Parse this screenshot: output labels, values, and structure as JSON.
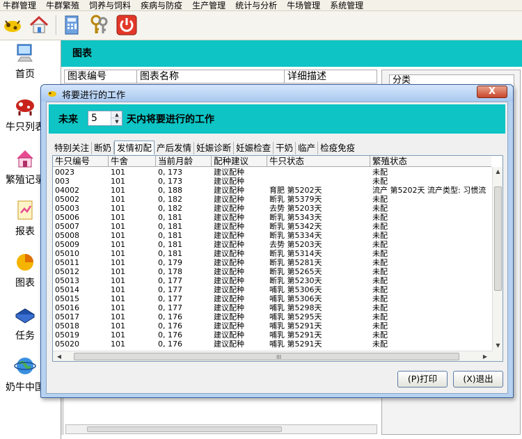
{
  "menu": [
    "牛群管理",
    "牛群繁殖",
    "饲养与饲料",
    "疾病与防疫",
    "生产管理",
    "统计与分析",
    "牛场管理",
    "系统管理"
  ],
  "nav": [
    {
      "label": "首页",
      "icon": "monitor-icon"
    },
    {
      "label": "牛只列表",
      "icon": "cow-icon"
    },
    {
      "label": "繁殖记录",
      "icon": "house-icon"
    },
    {
      "label": "报表",
      "icon": "report-icon"
    },
    {
      "label": "图表",
      "icon": "pie-chart-icon"
    },
    {
      "label": "任务",
      "icon": "book-icon"
    },
    {
      "label": "奶牛中国",
      "icon": "globe-icon"
    }
  ],
  "background": {
    "title": "图表",
    "headers": [
      "图表编号",
      "图表名称",
      "详细描述"
    ],
    "category": "分类"
  },
  "dialog": {
    "title": "将要进行的工作",
    "close": "X",
    "future": "未来",
    "days_value": "5",
    "days_label": "天内将要进行的工作",
    "tabs": [
      "特别关注",
      "断奶",
      "发情初配",
      "产后发情",
      "妊娠诊断",
      "妊娠检查",
      "干奶",
      "临产",
      "检疫免疫"
    ],
    "active_tab": 2,
    "columns": [
      "牛只编号",
      "牛舍",
      "当前月龄",
      "配种建议",
      "牛只状态",
      "繁殖状态"
    ],
    "rows": [
      [
        "0023",
        "101",
        "0, 173",
        "建议配种",
        "",
        "未配"
      ],
      [
        "003",
        "101",
        "0, 173",
        "建议配种",
        "",
        "未配"
      ],
      [
        "04002",
        "101",
        "0, 188",
        "建议配种",
        "育肥  第5202天",
        "流产  第5202天  流产类型: 习惯流"
      ],
      [
        "05002",
        "101",
        "0, 182",
        "建议配种",
        "断乳  第5379天",
        "未配"
      ],
      [
        "05003",
        "101",
        "0, 182",
        "建议配种",
        "去势  第5203天",
        "未配"
      ],
      [
        "05006",
        "101",
        "0, 181",
        "建议配种",
        "断乳  第5343天",
        "未配"
      ],
      [
        "05007",
        "101",
        "0, 181",
        "建议配种",
        "断乳  第5342天",
        "未配"
      ],
      [
        "05008",
        "101",
        "0, 181",
        "建议配种",
        "断乳  第5334天",
        "未配"
      ],
      [
        "05009",
        "101",
        "0, 181",
        "建议配种",
        "去势  第5203天",
        "未配"
      ],
      [
        "05010",
        "101",
        "0, 181",
        "建议配种",
        "断乳  第5314天",
        "未配"
      ],
      [
        "05011",
        "101",
        "0, 179",
        "建议配种",
        "断乳  第5281天",
        "未配"
      ],
      [
        "05012",
        "101",
        "0, 178",
        "建议配种",
        "断乳  第5265天",
        "未配"
      ],
      [
        "05013",
        "101",
        "0, 177",
        "建议配种",
        "断乳  第5230天",
        "未配"
      ],
      [
        "05014",
        "101",
        "0, 177",
        "建议配种",
        "哺乳  第5306天",
        "未配"
      ],
      [
        "05015",
        "101",
        "0, 177",
        "建议配种",
        "哺乳  第5306天",
        "未配"
      ],
      [
        "05016",
        "101",
        "0, 177",
        "建议配种",
        "哺乳  第5298天",
        "未配"
      ],
      [
        "05017",
        "101",
        "0, 176",
        "建议配种",
        "哺乳  第5295天",
        "未配"
      ],
      [
        "05018",
        "101",
        "0, 176",
        "建议配种",
        "哺乳  第5291天",
        "未配"
      ],
      [
        "05019",
        "101",
        "0, 176",
        "建议配种",
        "哺乳  第5291天",
        "未配"
      ],
      [
        "05020",
        "101",
        "0, 176",
        "建议配种",
        "哺乳  第5291天",
        "未配"
      ]
    ],
    "print_label": "(P)打印",
    "exit_label": "(X)退出"
  },
  "colors": {
    "banner": "#0ec4c4",
    "dialog_frame": "#b6d2f0"
  }
}
